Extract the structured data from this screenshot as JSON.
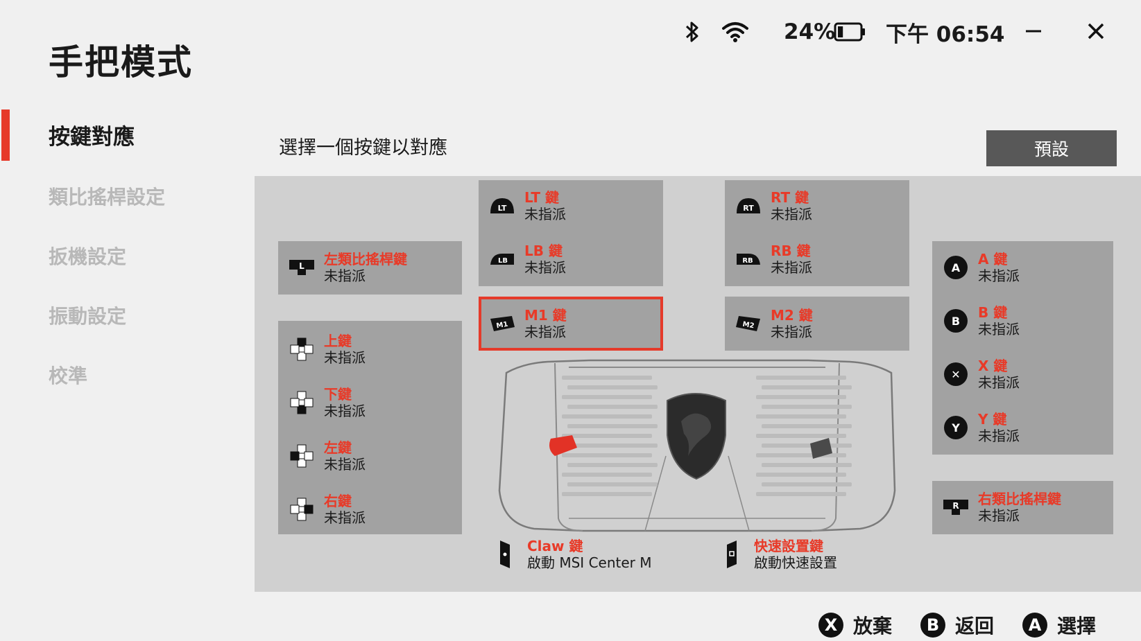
{
  "app": {
    "title": "手把模式"
  },
  "status": {
    "battery_percent": "24%",
    "battery_level": 0.24,
    "time": "下午 06:54"
  },
  "sidebar": {
    "items": [
      {
        "label": "按鍵對應",
        "active": true
      },
      {
        "label": "類比搖桿設定"
      },
      {
        "label": "扳機設定"
      },
      {
        "label": "振動設定"
      },
      {
        "label": "校準"
      }
    ]
  },
  "main": {
    "instruction": "選擇一個按鍵以對應",
    "default_button": "預設",
    "unassigned": "未指派",
    "keys": {
      "left_stick": {
        "name": "左類比搖桿鍵",
        "value": "未指派"
      },
      "up": {
        "name": "上鍵",
        "value": "未指派"
      },
      "down": {
        "name": "下鍵",
        "value": "未指派"
      },
      "left": {
        "name": "左鍵",
        "value": "未指派"
      },
      "right": {
        "name": "右鍵",
        "value": "未指派"
      },
      "lt": {
        "name": "LT 鍵",
        "value": "未指派"
      },
      "lb": {
        "name": "LB 鍵",
        "value": "未指派"
      },
      "m1": {
        "name": "M1 鍵",
        "value": "未指派"
      },
      "rt": {
        "name": "RT 鍵",
        "value": "未指派"
      },
      "rb": {
        "name": "RB 鍵",
        "value": "未指派"
      },
      "m2": {
        "name": "M2 鍵",
        "value": "未指派"
      },
      "a": {
        "name": "A 鍵",
        "value": "未指派"
      },
      "b": {
        "name": "B 鍵",
        "value": "未指派"
      },
      "x": {
        "name": "X 鍵",
        "value": "未指派"
      },
      "y": {
        "name": "Y 鍵",
        "value": "未指派"
      },
      "right_stick": {
        "name": "右類比搖桿鍵",
        "value": "未指派"
      },
      "claw": {
        "name": "Claw 鍵",
        "value": "啟動 MSI Center M"
      },
      "quick": {
        "name": "快速設置鍵",
        "value": "啟動快速設置"
      }
    },
    "icon_labels": {
      "lt": "LT",
      "lb": "LB",
      "rt": "RT",
      "rb": "RB",
      "m1": "M1",
      "m2": "M2",
      "a": "A",
      "b": "B",
      "x": "✕",
      "y": "Y",
      "l": "L",
      "r": "R"
    }
  },
  "footer": {
    "discard": {
      "glyph": "X",
      "label": "放棄"
    },
    "back": {
      "glyph": "B",
      "label": "返回"
    },
    "select": {
      "glyph": "A",
      "label": "選擇"
    }
  },
  "colors": {
    "accent": "#e63a2a",
    "panel": "#d0d0d0",
    "card": "#a2a2a2",
    "button": "#585858"
  }
}
